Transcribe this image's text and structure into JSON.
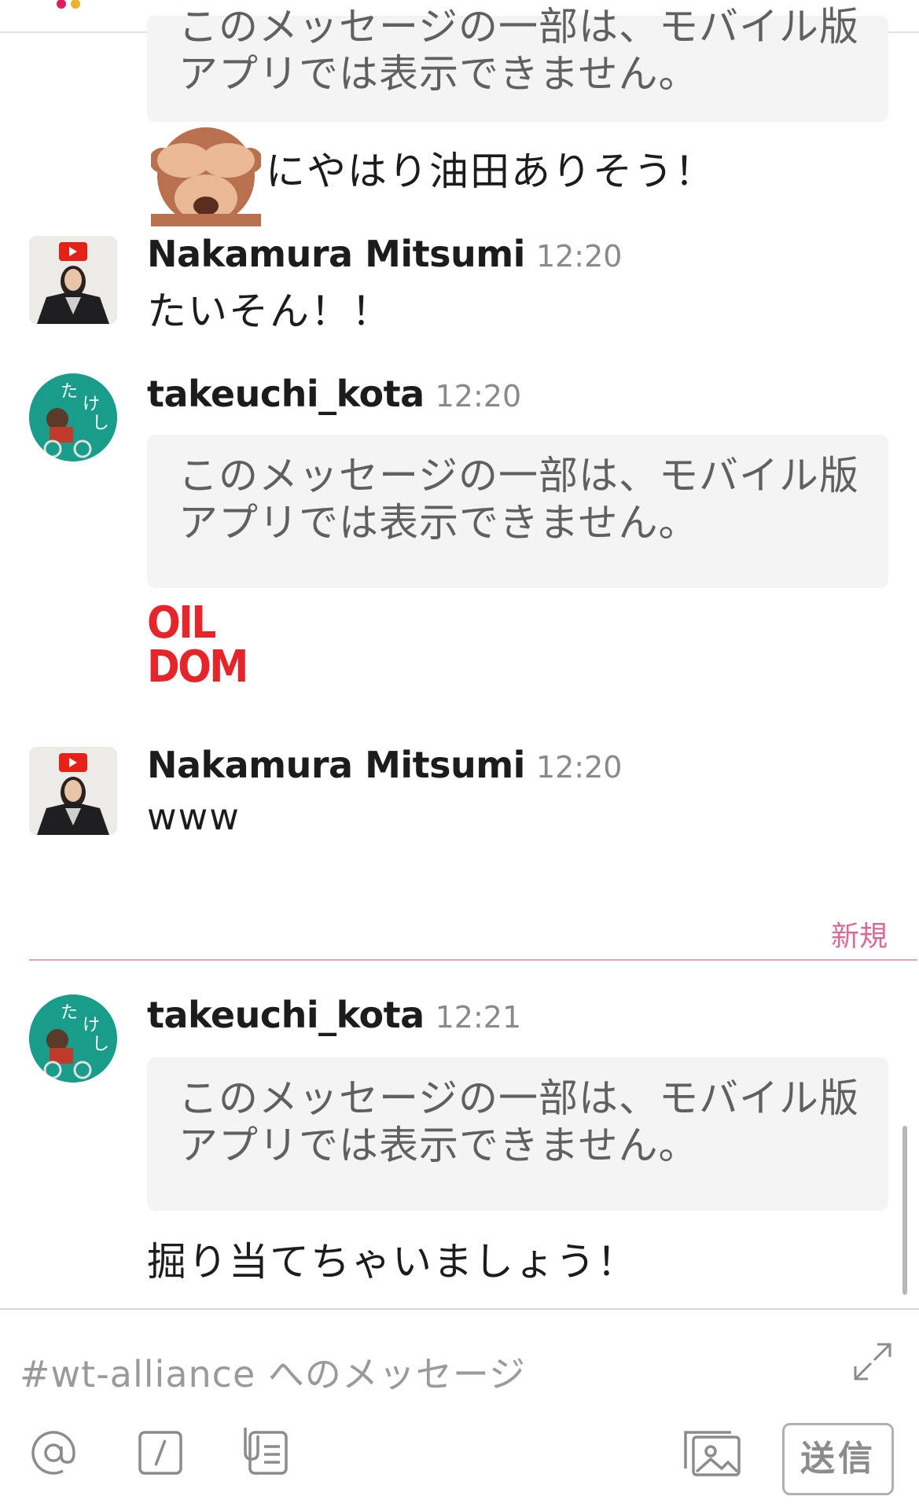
{
  "channel_placeholder": "#wt-alliance へのメッセージ",
  "messages": {
    "partial_notice_line1": "このメッセージの一部は、モバイル版",
    "partial_notice_line2": "アプリでは表示できません。",
    "monkey_text": "にやはり油田ありそう！",
    "m1": {
      "author": "Nakamura Mitsumi",
      "time": "12:20",
      "text": "たいそん！！"
    },
    "m2": {
      "author": "takeuchi_kota",
      "time": "12:20",
      "notice_line1": "このメッセージの一部は、モバイル版",
      "notice_line2": "アプリでは表示できません。",
      "emoji_line1": "OIL",
      "emoji_line2": "DOM"
    },
    "m3": {
      "author": "Nakamura Mitsumi",
      "time": "12:20",
      "text": "www"
    },
    "m4": {
      "author": "takeuchi_kota",
      "time": "12:21",
      "notice_line1": "このメッセージの一部は、モバイル版",
      "notice_line2": "アプリでは表示できません。",
      "text": "掘り当てちゃいましょう！"
    }
  },
  "new_label": "新規",
  "send_label": "送信",
  "colors": {
    "accent_new": "#d96a96",
    "oil_red": "#e5252a",
    "avatar_green": "#1a9c8a"
  }
}
